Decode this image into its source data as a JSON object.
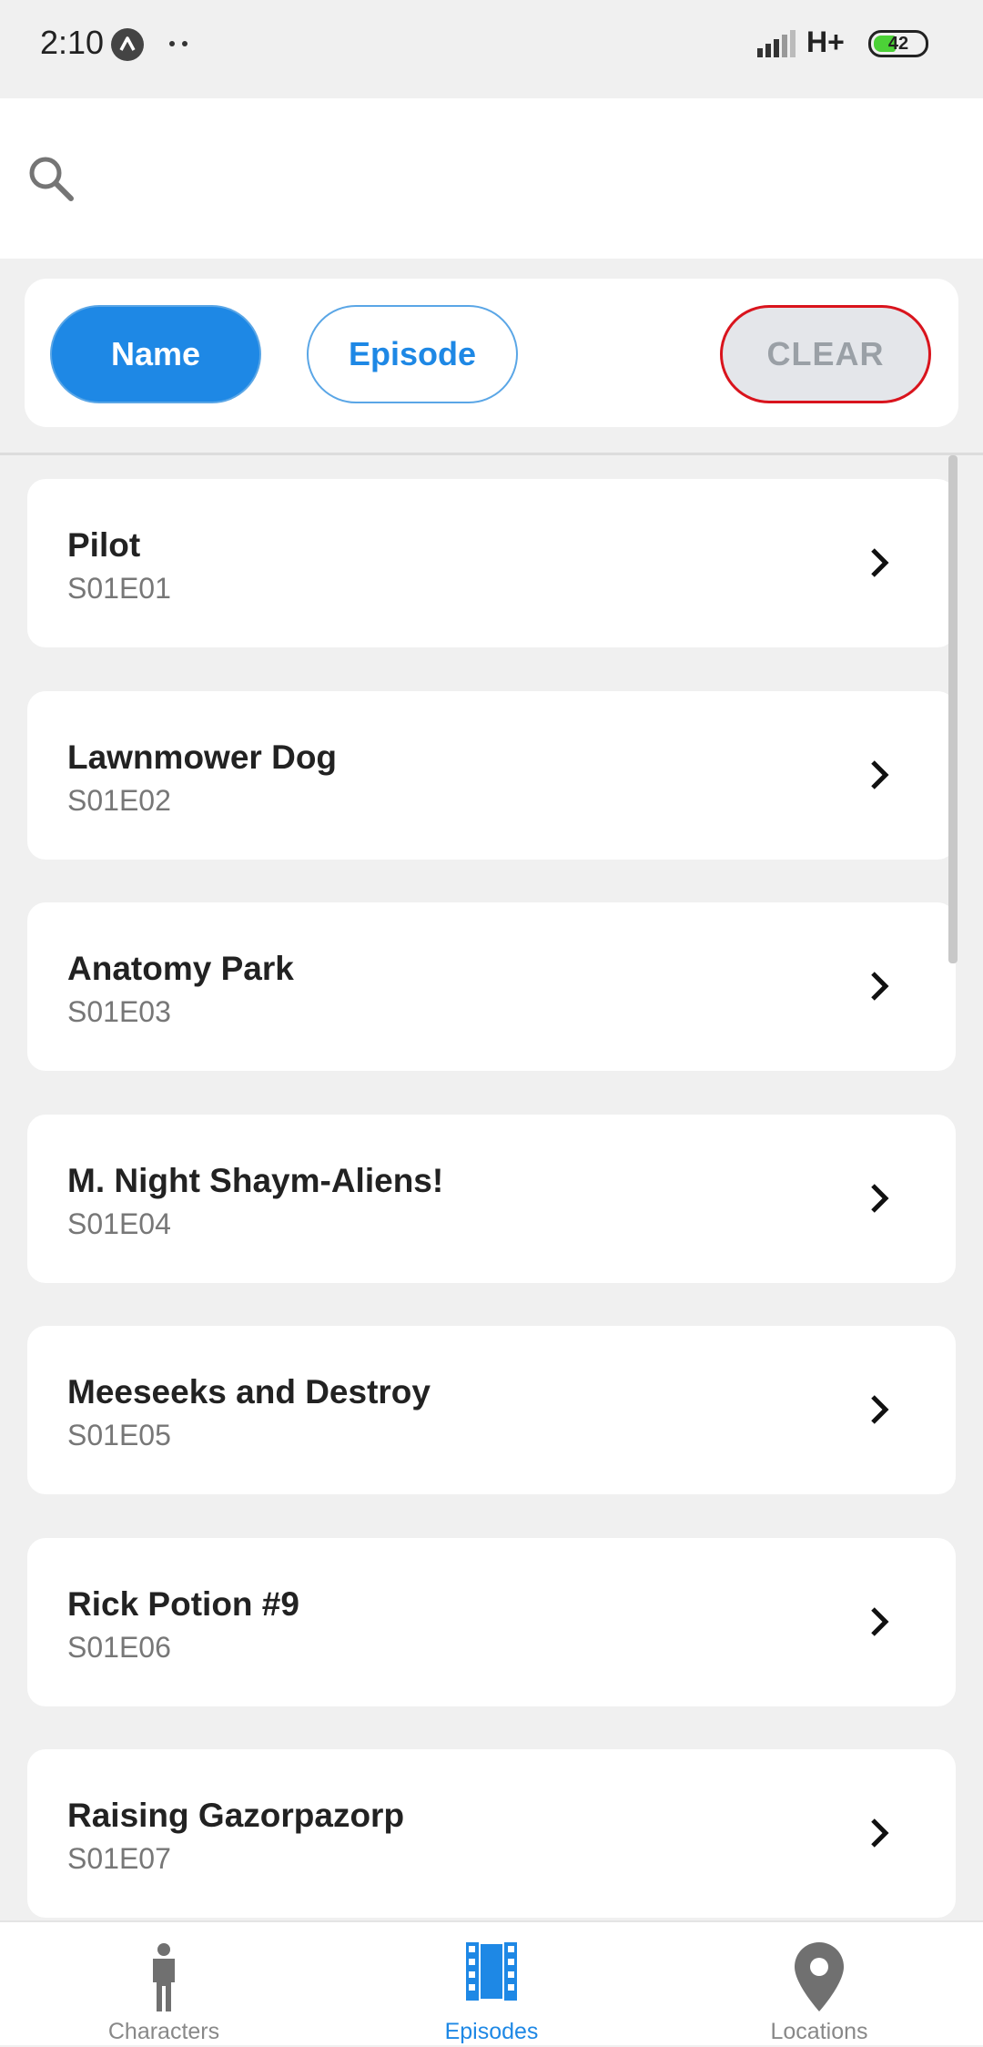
{
  "status_bar": {
    "time": "2:10",
    "network": "H+",
    "battery": "42"
  },
  "search": {
    "placeholder": "",
    "value": ""
  },
  "filters": {
    "name_label": "Name",
    "episode_label": "Episode",
    "clear_label": "CLEAR",
    "selected": "Name"
  },
  "episodes": [
    {
      "title": "Pilot",
      "code": "S01E01"
    },
    {
      "title": "Lawnmower Dog",
      "code": "S01E02"
    },
    {
      "title": "Anatomy Park",
      "code": "S01E03"
    },
    {
      "title": "M. Night Shaym-Aliens!",
      "code": "S01E04"
    },
    {
      "title": "Meeseeks and Destroy",
      "code": "S01E05"
    },
    {
      "title": "Rick Potion #9",
      "code": "S01E06"
    },
    {
      "title": "Raising Gazorpazorp",
      "code": "S01E07"
    }
  ],
  "bottom_nav": {
    "items": [
      {
        "label": "Characters",
        "icon": "person-icon"
      },
      {
        "label": "Episodes",
        "icon": "film-icon"
      },
      {
        "label": "Locations",
        "icon": "location-pin-icon"
      }
    ],
    "active": "Episodes"
  },
  "colors": {
    "accent": "#1e88e5",
    "clear_border": "#d9141d",
    "background": "#f0f0f0"
  }
}
